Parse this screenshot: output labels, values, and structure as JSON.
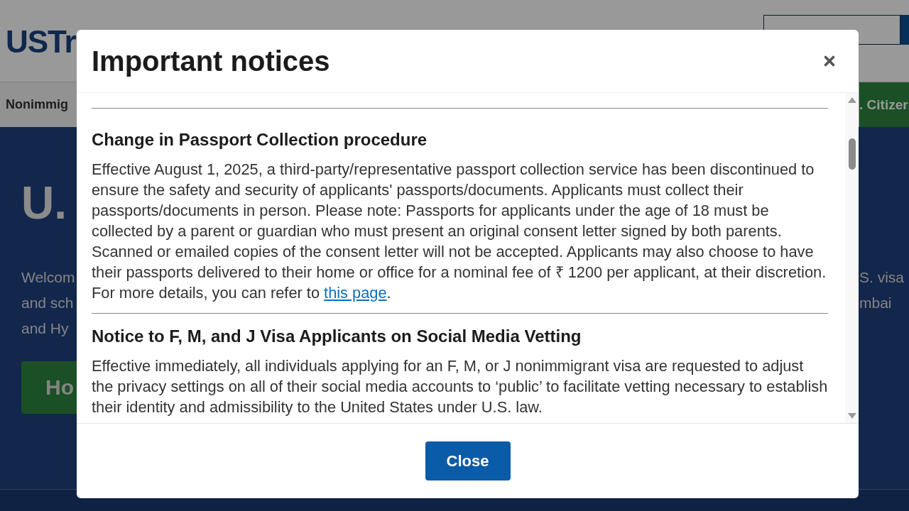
{
  "page": {
    "logo": "USTr",
    "nav_item": "Nonimmig",
    "nav_button": ". Citizer",
    "hero_title": "U.",
    "hero_lines": [
      {
        "left": "Welcom",
        "right": "S. visa"
      },
      {
        "left": "and sch",
        "right": "mbai"
      },
      {
        "left": "and Hy"
      }
    ],
    "hero_button": "Ho"
  },
  "dialog": {
    "title": "Important notices",
    "notices": [
      {
        "heading": "Change in Passport Collection procedure",
        "body": "Effective August 1, 2025, a third-party/representative passport collection service has been discontinued to ensure the safety and security of applicants' passports/documents. Applicants must collect their passports/documents in person. Please note: Passports for applicants under the age of 18 must be collected by a parent or guardian who must present an original consent letter signed by both parents. Scanned or emailed copies of the consent letter will not be accepted. Applicants may also choose to have their passports delivered to their home or office for a nominal fee of ₹ 1200 per applicant, at their discretion. For more details, you can refer to ",
        "link": "this page",
        "after": "."
      },
      {
        "heading": "Notice to F, M, and J Visa Applicants on Social Media Vetting",
        "body": "Effective immediately, all individuals applying for an F, M, or J nonimmigrant visa are requested to adjust the privacy settings on all of their social media accounts to ‘public’ to facilitate vetting necessary to establish their identity and admissibility to the United States under U.S. law."
      }
    ],
    "close_button": "Close"
  }
}
